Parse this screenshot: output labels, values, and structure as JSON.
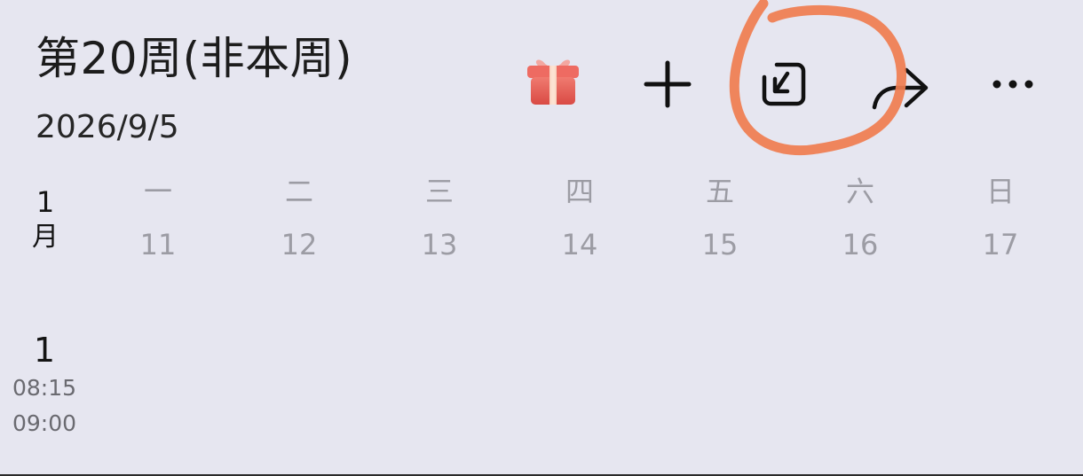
{
  "header": {
    "title": "第20周(非本周)",
    "date": "2026/9/5"
  },
  "toolbar": {
    "icons": [
      "gift-icon",
      "plus-icon",
      "import-icon",
      "share-icon",
      "more-icon"
    ],
    "highlight_color": "#f07d4f"
  },
  "calendar": {
    "month_number": "1",
    "month_char": "月",
    "weekdays": [
      "一",
      "二",
      "三",
      "四",
      "五",
      "六",
      "日"
    ],
    "days": [
      "11",
      "12",
      "13",
      "14",
      "15",
      "16",
      "17"
    ]
  },
  "sessions": [
    {
      "number": "1",
      "start": "08:15",
      "end": "09:00"
    }
  ],
  "colors": {
    "background": "#e6e6f0",
    "muted_text": "#9c9ca4",
    "gift_red": "#e9645c"
  }
}
